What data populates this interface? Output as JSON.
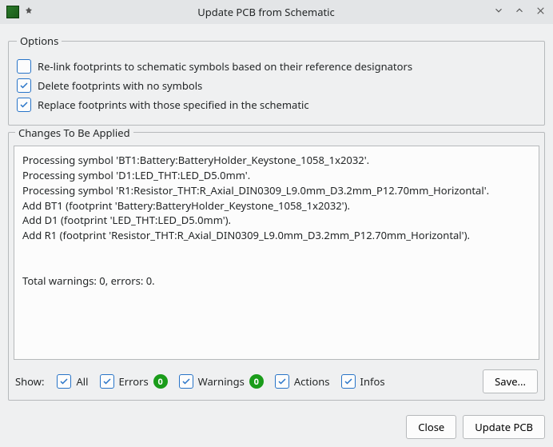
{
  "window": {
    "title": "Update PCB from Schematic"
  },
  "options": {
    "legend": "Options",
    "relink": {
      "label": "Re-link footprints to schematic symbols based on their reference designators",
      "checked": false
    },
    "delete": {
      "label": "Delete footprints with no symbols",
      "checked": true
    },
    "replace": {
      "label": "Replace footprints with those specified in the schematic",
      "checked": true
    }
  },
  "changes": {
    "legend": "Changes To Be Applied",
    "log": "Processing symbol 'BT1:Battery:BatteryHolder_Keystone_1058_1x2032'.\nProcessing symbol 'D1:LED_THT:LED_D5.0mm'.\nProcessing symbol 'R1:Resistor_THT:R_Axial_DIN0309_L9.0mm_D3.2mm_P12.70mm_Horizontal'.\nAdd BT1 (footprint 'Battery:BatteryHolder_Keystone_1058_1x2032').\nAdd D1 (footprint 'LED_THT:LED_D5.0mm').\nAdd R1 (footprint 'Resistor_THT:R_Axial_DIN0309_L9.0mm_D3.2mm_P12.70mm_Horizontal').\n\n\nTotal warnings: 0, errors: 0."
  },
  "filters": {
    "show_label": "Show:",
    "all": {
      "label": "All",
      "checked": true
    },
    "errors": {
      "label": "Errors",
      "checked": true,
      "count": "0"
    },
    "warnings": {
      "label": "Warnings",
      "checked": true,
      "count": "0"
    },
    "actions": {
      "label": "Actions",
      "checked": true
    },
    "infos": {
      "label": "Infos",
      "checked": true
    },
    "save_label": "Save..."
  },
  "footer": {
    "close_label": "Close",
    "update_label": "Update PCB"
  }
}
